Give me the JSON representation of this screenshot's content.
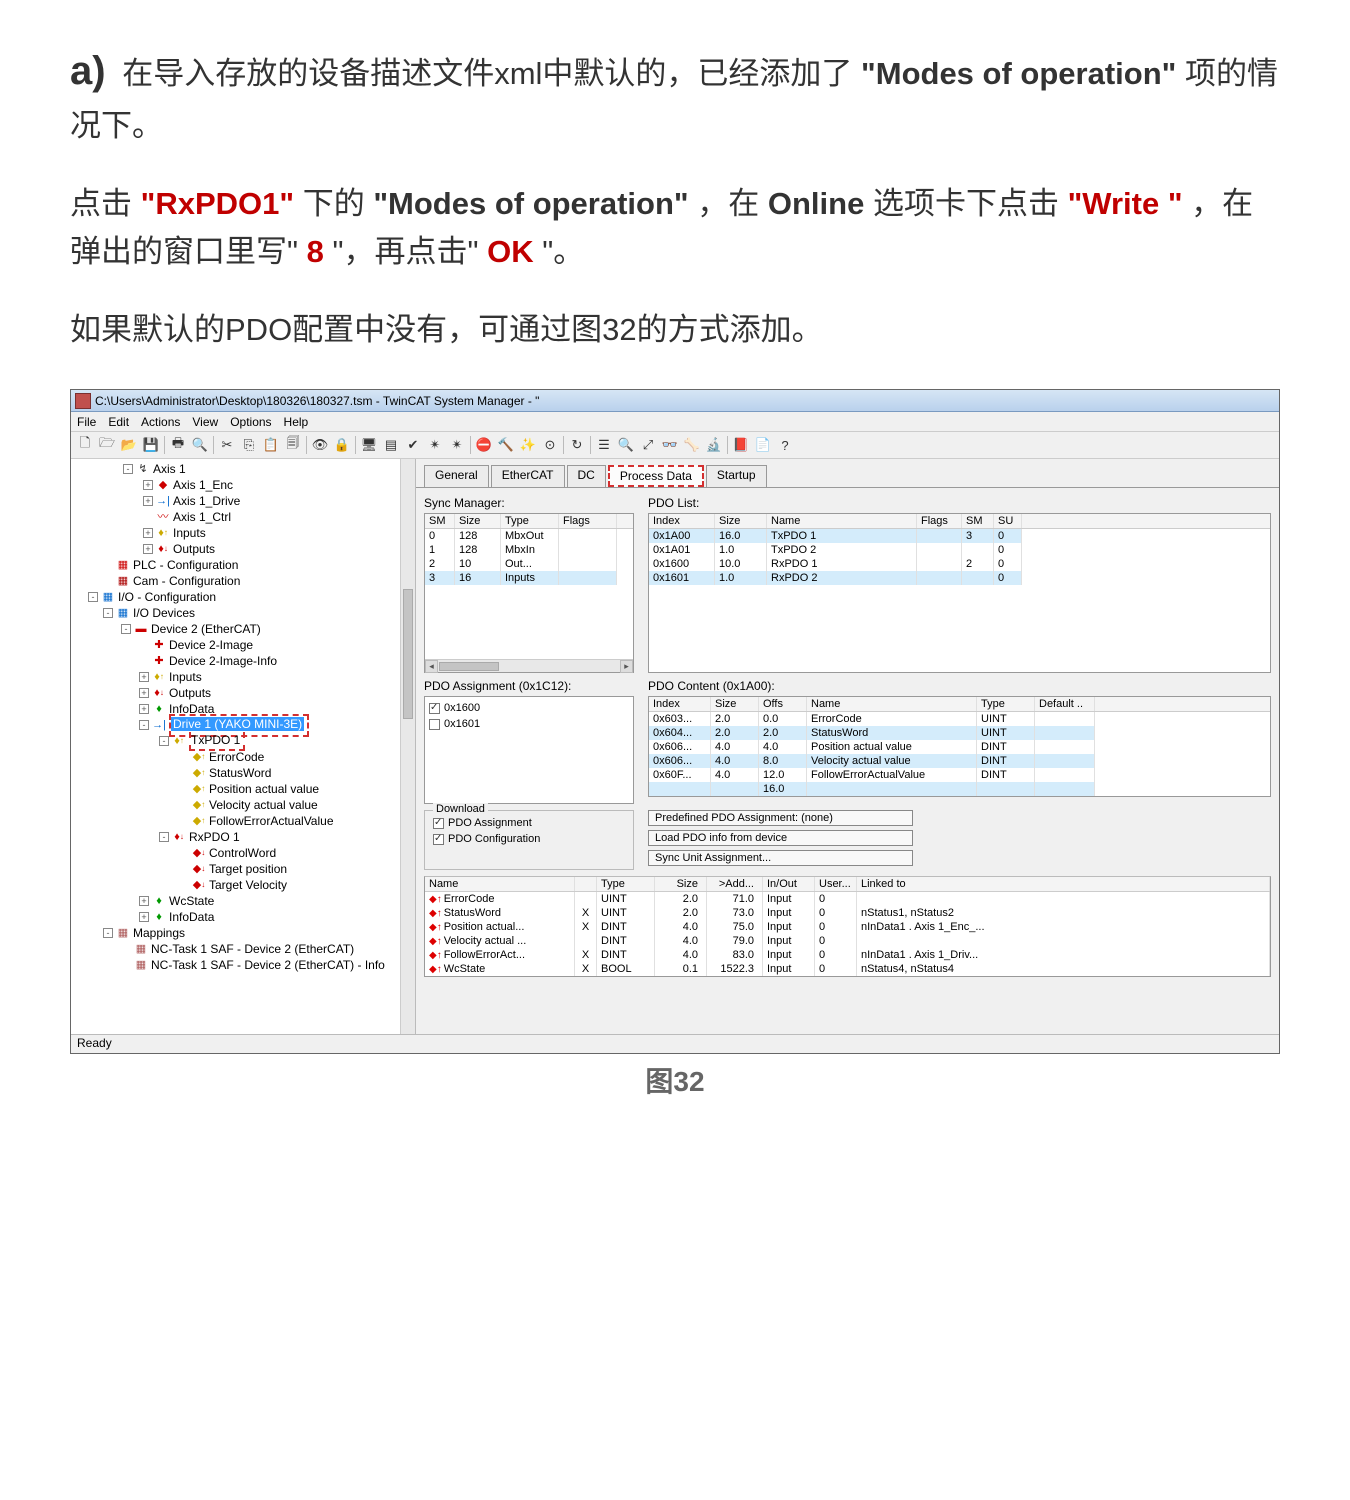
{
  "doc": {
    "label_a": "a)",
    "para1_pre": "在导入存放的设备描述文件xml中默认的，已经添加了",
    "para1_bold": "\"Modes of operation\"",
    "para1_post": "项的情况下。",
    "para2_pre": "点击",
    "para2_r1": "\"RxPDO1\"",
    "para2_m1": "下的",
    "para2_r2": "\"Modes of operation\"",
    "para2_m2": "，在",
    "para2_b1": "Online ",
    "para2_m3": "选项卡下点击",
    "para2_r3": "\"Write \"",
    "para2_m4": "，在弹出的窗口里写\"",
    "para2_r4": " 8 ",
    "para2_m5": "\"，再点击\"",
    "para2_r5": " OK ",
    "para2_m6": "\"。",
    "para3": "如果默认的PDO配置中没有，可通过图32的方式添加。",
    "fig_caption": "图32"
  },
  "window": {
    "title": "C:\\Users\\Administrator\\Desktop\\180326\\180327.tsm - TwinCAT System Manager - \"",
    "menus": [
      "File",
      "Edit",
      "Actions",
      "View",
      "Options",
      "Help"
    ],
    "status": "Ready"
  },
  "tree": [
    {
      "pad": 50,
      "tog": "-",
      "icon": "↯",
      "c": "#333",
      "label": "Axis 1"
    },
    {
      "pad": 70,
      "tog": "+",
      "icon": "◆",
      "c": "#c00",
      "label": "Axis 1_Enc"
    },
    {
      "pad": 70,
      "tog": "+",
      "icon": "→|",
      "c": "#06c",
      "label": "Axis 1_Drive"
    },
    {
      "pad": 70,
      "tog": "",
      "icon": "〰",
      "c": "#c00",
      "label": "Axis 1_Ctrl"
    },
    {
      "pad": 70,
      "tog": "+",
      "icon": "♦",
      "c": "#ca0",
      "label": "Inputs",
      "sub": "↑"
    },
    {
      "pad": 70,
      "tog": "+",
      "icon": "♦",
      "c": "#c00",
      "label": "Outputs",
      "sub": "↓"
    },
    {
      "pad": 30,
      "tog": "",
      "icon": "▦",
      "c": "#c00",
      "label": "PLC - Configuration"
    },
    {
      "pad": 30,
      "tog": "",
      "icon": "▦",
      "c": "#a00",
      "label": "Cam - Configuration"
    },
    {
      "pad": 15,
      "tog": "-",
      "icon": "▦",
      "c": "#06c",
      "label": "I/O - Configuration"
    },
    {
      "pad": 30,
      "tog": "-",
      "icon": "▦",
      "c": "#06c",
      "label": "I/O Devices"
    },
    {
      "pad": 48,
      "tog": "-",
      "icon": "▬",
      "c": "#c00",
      "label": "Device 2 (EtherCAT)"
    },
    {
      "pad": 66,
      "tog": "",
      "icon": "✚",
      "c": "#c00",
      "label": "Device 2-Image"
    },
    {
      "pad": 66,
      "tog": "",
      "icon": "✚",
      "c": "#c00",
      "label": "Device 2-Image-Info"
    },
    {
      "pad": 66,
      "tog": "+",
      "icon": "♦",
      "c": "#ca0",
      "label": "Inputs",
      "sub": "↑"
    },
    {
      "pad": 66,
      "tog": "+",
      "icon": "♦",
      "c": "#c00",
      "label": "Outputs",
      "sub": "↓"
    },
    {
      "pad": 66,
      "tog": "+",
      "icon": "♦",
      "c": "#090",
      "label": "InfoData"
    },
    {
      "pad": 66,
      "tog": "-",
      "icon": "→|",
      "c": "#06c",
      "label": "Drive 1 (YAKO MINI-3E)",
      "selected": true,
      "reddash": true
    },
    {
      "pad": 86,
      "tog": "-",
      "icon": "♦",
      "c": "#ca0",
      "label": "TxPDO 1",
      "sub": "↑",
      "reddash2": true
    },
    {
      "pad": 106,
      "tog": "",
      "icon": "◆",
      "c": "#ca0",
      "label": "ErrorCode",
      "sub": "↑"
    },
    {
      "pad": 106,
      "tog": "",
      "icon": "◆",
      "c": "#ca0",
      "label": "StatusWord",
      "sub": "↑"
    },
    {
      "pad": 106,
      "tog": "",
      "icon": "◆",
      "c": "#ca0",
      "label": "Position actual value",
      "sub": "↑"
    },
    {
      "pad": 106,
      "tog": "",
      "icon": "◆",
      "c": "#ca0",
      "label": "Velocity actual value",
      "sub": "↑"
    },
    {
      "pad": 106,
      "tog": "",
      "icon": "◆",
      "c": "#ca0",
      "label": "FollowErrorActualValue",
      "sub": "↑"
    },
    {
      "pad": 86,
      "tog": "-",
      "icon": "♦",
      "c": "#c00",
      "label": "RxPDO 1",
      "sub": "↓"
    },
    {
      "pad": 106,
      "tog": "",
      "icon": "◆",
      "c": "#c00",
      "label": "ControlWord",
      "sub": "↓"
    },
    {
      "pad": 106,
      "tog": "",
      "icon": "◆",
      "c": "#c00",
      "label": "Target position",
      "sub": "↓"
    },
    {
      "pad": 106,
      "tog": "",
      "icon": "◆",
      "c": "#c00",
      "label": "Target Velocity",
      "sub": "↓"
    },
    {
      "pad": 66,
      "tog": "+",
      "icon": "♦",
      "c": "#090",
      "label": "WcState"
    },
    {
      "pad": 66,
      "tog": "+",
      "icon": "♦",
      "c": "#090",
      "label": "InfoData"
    },
    {
      "pad": 30,
      "tog": "-",
      "icon": "▦",
      "c": "#a55",
      "label": "Mappings"
    },
    {
      "pad": 48,
      "tog": "",
      "icon": "▦",
      "c": "#a55",
      "label": "NC-Task 1 SAF - Device 2 (EtherCAT)"
    },
    {
      "pad": 48,
      "tog": "",
      "icon": "▦",
      "c": "#a55",
      "label": "NC-Task 1 SAF - Device 2 (EtherCAT) - Info"
    }
  ],
  "tabs": {
    "items": [
      "General",
      "EtherCAT",
      "DC",
      "Process Data",
      "Startup"
    ],
    "active": 3
  },
  "sync_manager": {
    "title": "Sync Manager:",
    "headers": [
      "SM",
      "Size",
      "Type",
      "Flags"
    ],
    "rows": [
      [
        "0",
        "128",
        "MbxOut",
        ""
      ],
      [
        "1",
        "128",
        "MbxIn",
        ""
      ],
      [
        "2",
        "10",
        "Out...",
        ""
      ],
      [
        "3",
        "16",
        "Inputs",
        ""
      ]
    ]
  },
  "pdo_list": {
    "title": "PDO List:",
    "headers": [
      "Index",
      "Size",
      "Name",
      "Flags",
      "SM",
      "SU"
    ],
    "rows": [
      {
        "cells": [
          "0x1A00",
          "16.0",
          "TxPDO 1",
          "",
          "3",
          "0"
        ],
        "blue": true
      },
      {
        "cells": [
          "0x1A01",
          "1.0",
          "TxPDO 2",
          "",
          "",
          "0"
        ],
        "blue": false
      },
      {
        "cells": [
          "0x1600",
          "10.0",
          "RxPDO 1",
          "",
          "2",
          "0"
        ],
        "blue": false
      },
      {
        "cells": [
          "0x1601",
          "1.0",
          "RxPDO 2",
          "",
          "",
          "0"
        ],
        "blue": true
      }
    ]
  },
  "assignment": {
    "title": "PDO Assignment (0x1C12):",
    "items": [
      {
        "label": "0x1600",
        "checked": true
      },
      {
        "label": "0x1601",
        "checked": false
      }
    ]
  },
  "pdo_content": {
    "title": "PDO Content (0x1A00):",
    "headers": [
      "Index",
      "Size",
      "Offs",
      "Name",
      "Type",
      "Default .."
    ],
    "rows": [
      {
        "cells": [
          "0x603...",
          "2.0",
          "0.0",
          "ErrorCode",
          "UINT",
          ""
        ]
      },
      {
        "cells": [
          "0x604...",
          "2.0",
          "2.0",
          "StatusWord",
          "UINT",
          ""
        ],
        "blue": true
      },
      {
        "cells": [
          "0x606...",
          "4.0",
          "4.0",
          "Position actual value",
          "DINT",
          ""
        ]
      },
      {
        "cells": [
          "0x606...",
          "4.0",
          "8.0",
          "Velocity actual value",
          "DINT",
          ""
        ],
        "blue": true
      },
      {
        "cells": [
          "0x60F...",
          "4.0",
          "12.0",
          "FollowErrorActualValue",
          "DINT",
          ""
        ]
      },
      {
        "cells": [
          "",
          "",
          "16.0",
          "",
          "",
          ""
        ],
        "blue": true
      }
    ]
  },
  "download": {
    "legend": "Download",
    "items": [
      {
        "label": "PDO Assignment",
        "checked": true
      },
      {
        "label": "PDO Configuration",
        "checked": true
      }
    ]
  },
  "predefined": {
    "label": "Predefined PDO Assignment: (none)",
    "btn1": "Load PDO info from device",
    "btn2": "Sync Unit Assignment..."
  },
  "var_grid": {
    "headers": [
      "Name",
      "",
      "Type",
      "Size",
      ">Add...",
      "In/Out",
      "User...",
      "Linked to"
    ],
    "rows": [
      {
        "dir": "up",
        "name": "ErrorCode",
        "x": "",
        "type": "UINT",
        "size": "2.0",
        "addr": "71.0",
        "io": "Input",
        "user": "0",
        "linked": ""
      },
      {
        "dir": "up",
        "name": "StatusWord",
        "x": "X",
        "type": "UINT",
        "size": "2.0",
        "addr": "73.0",
        "io": "Input",
        "user": "0",
        "linked": "nStatus1, nStatus2"
      },
      {
        "dir": "up",
        "name": "Position actual...",
        "x": "X",
        "type": "DINT",
        "size": "4.0",
        "addr": "75.0",
        "io": "Input",
        "user": "0",
        "linked": "nInData1 . Axis 1_Enc_..."
      },
      {
        "dir": "up",
        "name": "Velocity actual ...",
        "x": "",
        "type": "DINT",
        "size": "4.0",
        "addr": "79.0",
        "io": "Input",
        "user": "0",
        "linked": ""
      },
      {
        "dir": "up",
        "name": "FollowErrorAct...",
        "x": "X",
        "type": "DINT",
        "size": "4.0",
        "addr": "83.0",
        "io": "Input",
        "user": "0",
        "linked": "nInData1 . Axis 1_Driv..."
      },
      {
        "dir": "up",
        "name": "WcState",
        "x": "X",
        "type": "BOOL",
        "size": "0.1",
        "addr": "1522.3",
        "io": "Input",
        "user": "0",
        "linked": "nStatus4, nStatus4"
      }
    ]
  }
}
